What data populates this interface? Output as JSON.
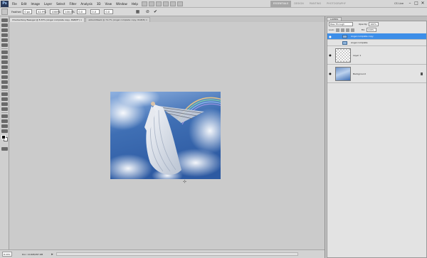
{
  "menubar": {
    "logo": "Ps",
    "items": [
      "File",
      "Edit",
      "Image",
      "Layer",
      "Select",
      "Filter",
      "Analysis",
      "3D",
      "View",
      "Window",
      "Help"
    ],
    "workspaces": [
      "ESSENTIALS",
      "DESIGN",
      "PAINTING",
      "PHOTOGRAPHY"
    ],
    "cs_live": "CS Live",
    "controls": [
      "–",
      "□",
      "✕"
    ]
  },
  "options": {
    "feather_label": "Feather:",
    "feather_value": "0 px",
    "fields": [
      "42.9%",
      "1000%",
      "100.0%",
      "0.0",
      "0.0",
      "0.0"
    ]
  },
  "tabs": [
    "Checkerdany Beaugel @ 8.33% (Angel complete copy, RGB/8*) ×",
    "ebbe4d6aa9 @ 74.7% (Angel complete copy, RGB/8) ×"
  ],
  "status": {
    "zoom": "8.33%",
    "doc_info": "Doc: 10.6M/287.9M"
  },
  "layers": {
    "tab_label": "LAYERS",
    "blend_mode": "Pass Through",
    "opacity_label": "Opacity:",
    "opacity": "100%",
    "lock_label": "Lock:",
    "fill_label": "Fill:",
    "fill": "100%",
    "rows": [
      {
        "name": "Angel complete copy",
        "selected": true
      },
      {
        "name": "Angel complete",
        "selected": false
      },
      {
        "name": "Layer 1",
        "selected": false
      },
      {
        "name": "Background",
        "selected": false
      }
    ]
  },
  "colors": {
    "selection": "#3d8ee8",
    "sky": "#3f6fb4"
  }
}
